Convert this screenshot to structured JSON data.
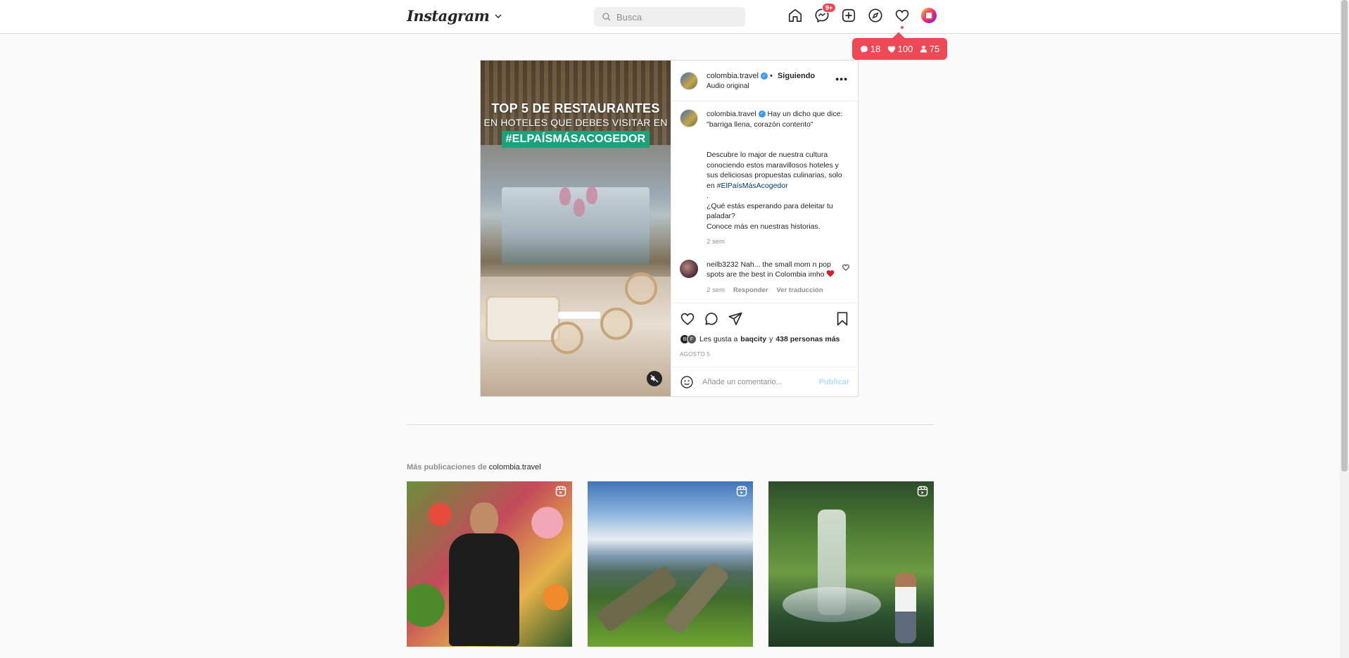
{
  "nav": {
    "logo": "Instagram",
    "search_placeholder": "Busca",
    "messages_badge": "9+"
  },
  "notifications": {
    "comments": "18",
    "likes": "100",
    "followers": "75"
  },
  "post": {
    "media": {
      "line1": "TOP 5 DE RESTAURANTES",
      "line2": "EN HOTELES QUE DEBES VISITAR EN",
      "line3": "#ELPAÍSMÁSACOGEDOR"
    },
    "header": {
      "username": "colombia.travel",
      "following": "Siguiendo",
      "separator": "•",
      "subtitle": "Audio original"
    },
    "caption": {
      "username": "colombia.travel",
      "line1": "Hay un dicho que dice: \"barriga llena, corazón contento\"",
      "line2": "Descubre lo major de nuestra cultura conociendo estos maravillosos hoteles y sus deliciosas propuestas culinarias, solo en",
      "hashtag": "#ElPaísMásAcogedor",
      "dot": ".",
      "line3": "¿Qué estás esperando para deleitar tu paladar?",
      "line4": "Conoce más en nuestras historias.",
      "time": "2 sem"
    },
    "comment": {
      "username": "neilb3232",
      "text": "Nah... the small mom n pop spots are the best in Colombia imho",
      "time": "2 sem",
      "reply": "Responder",
      "translate": "Ver traducción"
    },
    "likes": {
      "prefix": "Les gusta a",
      "user": "baqcity",
      "connector": "y",
      "others": "438 personas más"
    },
    "date": "AGOSTO 5",
    "add_comment_placeholder": "Añade un comentario...",
    "publish": "Publicar"
  },
  "more": {
    "prefix": "Más publicaciones de",
    "username": "colombia.travel"
  },
  "colors": {
    "accent_red": "#ed4956",
    "link_blue": "#00376b",
    "publish_blue": "#b2dffc",
    "hashtag_green": "#18a37a"
  }
}
